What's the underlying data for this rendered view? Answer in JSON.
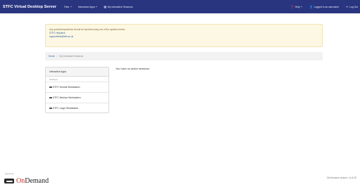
{
  "navbar": {
    "brand": "STFC Virtual Desktop Server",
    "menus": [
      {
        "label": "Files",
        "dropdown": true
      },
      {
        "label": "Interactive Apps",
        "dropdown": true
      },
      {
        "label": "My Interactive Sessions",
        "icon": "sessions-icon"
      }
    ],
    "right": [
      {
        "label": "Help",
        "icon": "help-icon",
        "dropdown": true
      },
      {
        "label": "Logged in as username",
        "icon": "user-icon"
      },
      {
        "label": "Log Out",
        "icon": "logout-icon"
      }
    ],
    "bg_color": "#2a3580"
  },
  "alert": {
    "message": "Any questions/problems should be reported using one of the systems below:",
    "links": [
      "STFC Helpdesk",
      "supportdesk@stfc.ac.uk"
    ]
  },
  "breadcrumb": {
    "home": "Home",
    "current": "My Interactive Sessions"
  },
  "apps_panel": {
    "heading": "Interactive Apps",
    "section": "Desktops",
    "items": [
      "STFC Normal Workstation",
      "STFC Medium Workstation",
      "STFC Large Workstation"
    ]
  },
  "main": {
    "empty_message": "You have no active sessions."
  },
  "footer": {
    "powered_by": "powered by",
    "logo_on": "On",
    "logo_demand": "Demand",
    "version": "OnDemand version: v1.8.20"
  }
}
